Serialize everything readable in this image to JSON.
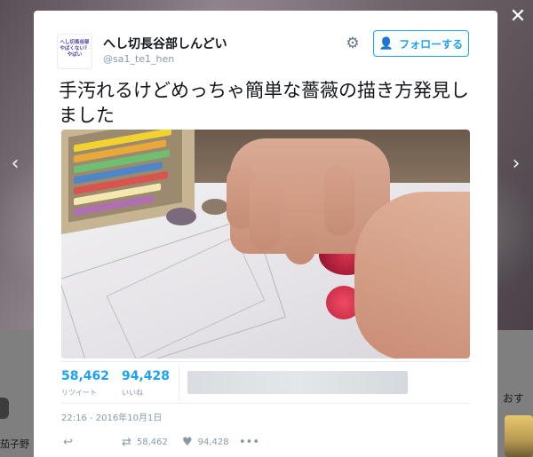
{
  "background": {
    "left_text": "茄子野",
    "right_text": "おす"
  },
  "nav": {
    "prev_icon": "‹",
    "next_icon": "›",
    "close_icon": "✕"
  },
  "tweet": {
    "avatar_lines": [
      "へし切長谷部",
      "やばくない？",
      "やばい"
    ],
    "display_name": "へし切長谷部しんどい",
    "handle": "@sa1_te1_hen",
    "follow_label": "フォローする",
    "text": "手汚れるけどめっちゃ簡単な薔薇の描き方発見しました",
    "stats": {
      "retweets_value": "58,462",
      "retweets_label": "リツイート",
      "likes_value": "94,428",
      "likes_label": "いいね"
    },
    "timestamp": "22:16 - 2016年10月1日",
    "actions": {
      "retweet_count": "58,462",
      "like_count": "94,428",
      "more_label": "•••"
    }
  },
  "colors": {
    "accent": "#1da1f2",
    "muted": "#8899a6",
    "text": "#14171a"
  }
}
